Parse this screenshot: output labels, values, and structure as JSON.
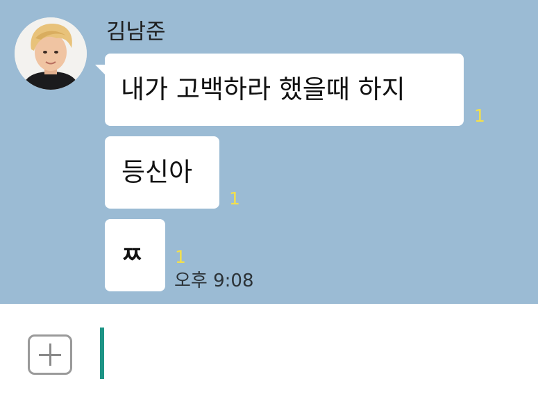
{
  "chat": {
    "sender_name": "김남준",
    "messages": [
      {
        "text": "내가 고백하라 했을때 하지",
        "unread": "1"
      },
      {
        "text": "등신아",
        "unread": "1"
      },
      {
        "text": "ㅉ",
        "unread": "1"
      }
    ],
    "last_timestamp": "오후 9:08"
  },
  "input_bar": {
    "attach_icon": "plus-icon",
    "message_value": ""
  },
  "colors": {
    "chat_background": "#9bbbd4",
    "bubble": "#ffffff",
    "unread_badge": "#f4e04a",
    "cursor": "#1d9485"
  }
}
